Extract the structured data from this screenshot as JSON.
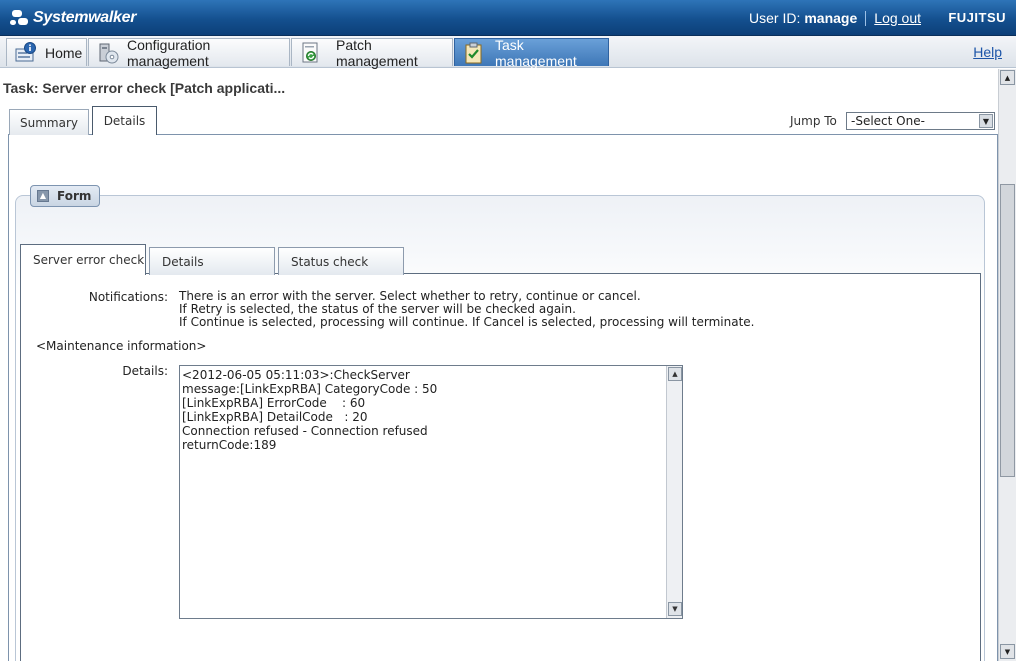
{
  "header": {
    "brand": "Systemwalker",
    "user_label": "User ID:",
    "user_id": "manage",
    "logout": "Log out",
    "vendor": "FUJITSU",
    "colors": {
      "header_blue": "#14508f",
      "active_tab": "#3e77b7"
    }
  },
  "nav": {
    "tabs": [
      {
        "label": "Home",
        "icon": "home-info-icon"
      },
      {
        "label": "Configuration management",
        "icon": "computer-cd-icon"
      },
      {
        "label": "Patch management",
        "icon": "patch-document-icon"
      },
      {
        "label": "Task management",
        "icon": "clipboard-check-icon",
        "active": true
      }
    ],
    "help": "Help"
  },
  "task": {
    "title": "Task: Server error check [Patch applicati...",
    "tabs": [
      {
        "label": "Summary"
      },
      {
        "label": "Details",
        "active": true
      }
    ],
    "jump_label": "Jump To",
    "jump_value": "-Select One-"
  },
  "form": {
    "title": "Form",
    "tabs": [
      {
        "label": "Server error check",
        "active": true
      },
      {
        "label": "Details"
      },
      {
        "label": "Status check"
      }
    ],
    "notifications_label": "Notifications:",
    "notifications": [
      "There is an error with the server. Select whether to retry, continue or cancel.",
      "If Retry is selected, the status of the server will be checked again.",
      "If Continue is selected, processing will continue. If Cancel is selected, processing will terminate."
    ],
    "maintenance_heading": "<Maintenance information>",
    "details_label": "Details:",
    "details_text": "<2012-06-05 05:11:03>:CheckServer\nmessage:[LinkExpRBA] CategoryCode : 50\n[LinkExpRBA] ErrorCode    : 60\n[LinkExpRBA] DetailCode   : 20\nConnection refused - Connection refused\nreturnCode:189"
  }
}
